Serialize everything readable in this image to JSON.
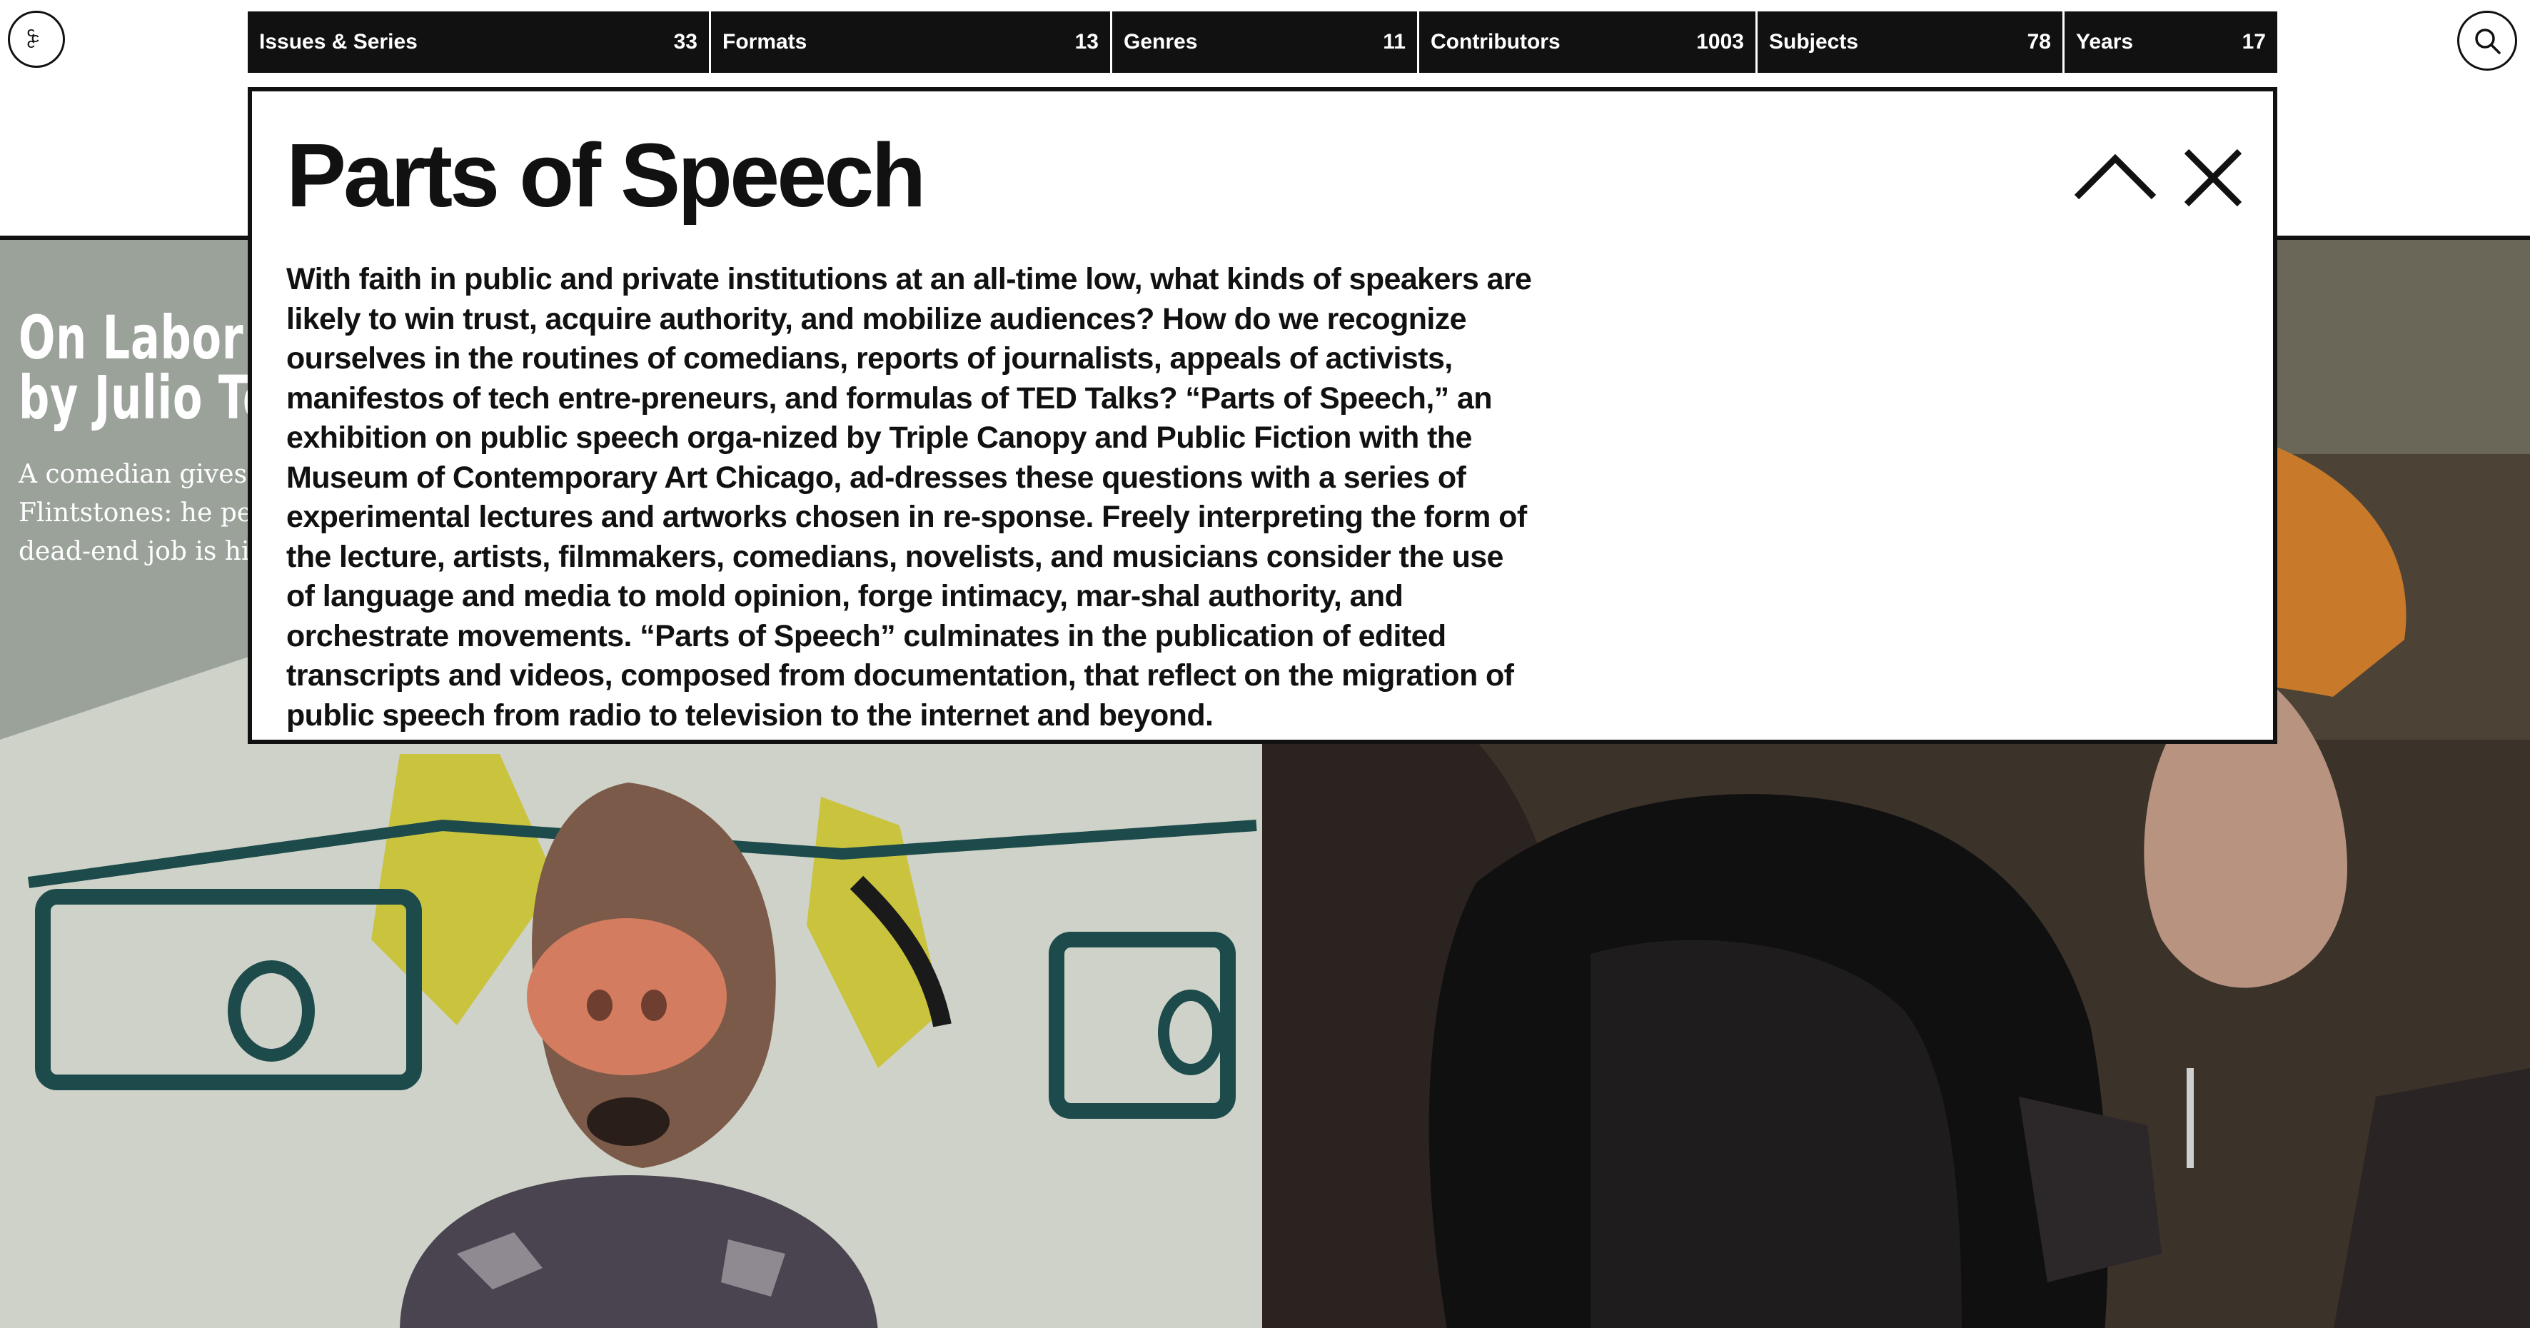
{
  "logo": {
    "letters": "C C C"
  },
  "nav": [
    {
      "label": "Issues & Series",
      "count": "33"
    },
    {
      "label": "Formats",
      "count": "13"
    },
    {
      "label": "Genres",
      "count": "11"
    },
    {
      "label": "Contributors",
      "count": "1003"
    },
    {
      "label": "Subjects",
      "count": "78"
    },
    {
      "label": "Years",
      "count": "17"
    }
  ],
  "background": {
    "article_title_line1": "On Labor a",
    "article_title_line2": "by Julio Tor",
    "excerpt_line1": "A comedian gives v",
    "excerpt_line2": "Flintstones: he peti",
    "excerpt_line3": "dead-end job is his"
  },
  "overlay": {
    "title": "Parts of Speech",
    "description": "With faith in public and private institutions at an all-time low, what kinds of speakers are likely to win trust, acquire authority, and mobilize audiences? How do we recognize ourselves in the routines of comedians, reports of journalists, appeals of activists, manifestos of tech entre-preneurs, and formulas of TED Talks? “Parts of Speech,” an exhibition on public speech orga-nized by Triple Canopy and Public Fiction with the Museum of Contemporary Art Chicago, ad-dresses these questions with a series of experimental lectures and artworks chosen in re-sponse. Freely interpreting the form of the lecture, artists, filmmakers, comedians, novelists, and musicians consider the use of language and media to mold opinion, forge intimacy, mar-shal authority, and orchestrate movements. “Parts of Speech” culminates in the publication of edited transcripts and videos, composed from documentation, that reflect on the migration of public speech from radio to television to the internet and beyond."
  },
  "icons": {
    "logo": "triple-canopy-logo-icon",
    "search": "search-icon",
    "collapse": "chevron-up-icon",
    "close": "close-icon"
  },
  "colors": {
    "nav_bg": "#111111",
    "nav_text": "#ffffff",
    "overlay_border": "#111111"
  }
}
